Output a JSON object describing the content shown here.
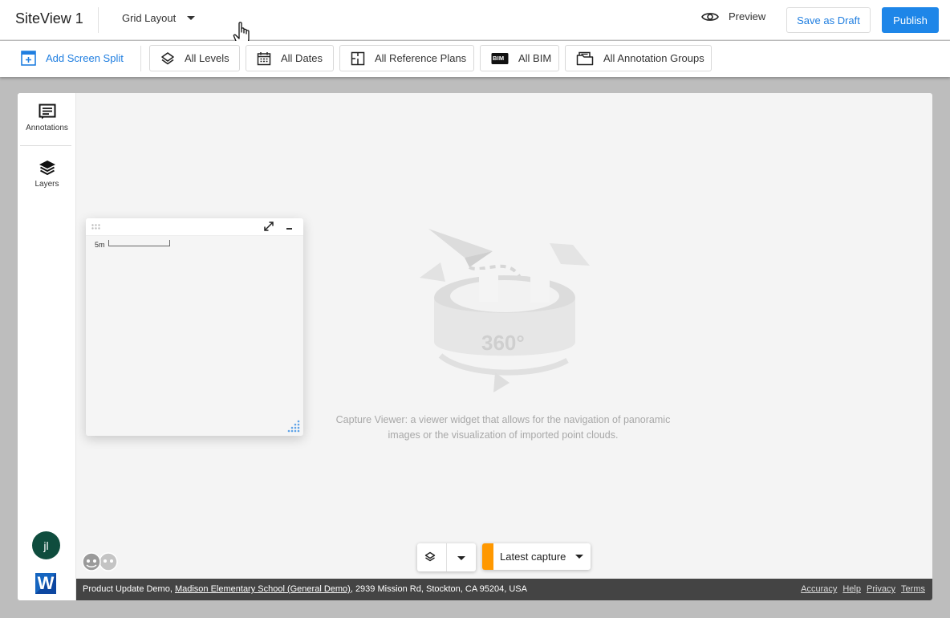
{
  "header": {
    "app_title": "SiteView 1",
    "layout_select": "Grid Layout",
    "preview_label": "Preview",
    "save_draft_label": "Save as Draft",
    "publish_label": "Publish"
  },
  "filters": {
    "add_screen_split": "Add Screen Split",
    "items": [
      {
        "label": "All Levels",
        "icon": "layers-icon"
      },
      {
        "label": "All Dates",
        "icon": "calendar-icon"
      },
      {
        "label": "All Reference Plans",
        "icon": "plan-icon"
      },
      {
        "label": "All BIM",
        "icon": "bim-icon",
        "badge": "BIM"
      },
      {
        "label": "All Annotation Groups",
        "icon": "folder-icon"
      }
    ]
  },
  "sidebar": {
    "items": [
      {
        "label": "Annotations",
        "icon": "annotations-icon"
      },
      {
        "label": "Layers",
        "icon": "layers-stack-icon"
      }
    ],
    "avatar_initials": "jl",
    "logo_letter": "W"
  },
  "viewer": {
    "badge_360": "360°",
    "description": "Capture Viewer: a viewer widget that allows for the navigation of panoramic images or the visualization of imported point clouds."
  },
  "minimap": {
    "scale_label": "5m"
  },
  "capture": {
    "selected": "Latest capture",
    "accent_color": "#ff9800"
  },
  "footer": {
    "project": "Product Update Demo, ",
    "site_link": "Madison Elementary School (General Demo)",
    "address": ", 2939 Mission Rd, Stockton, CA 95204, USA",
    "links": [
      "Accuracy",
      "Help",
      "Privacy",
      "Terms"
    ]
  },
  "colors": {
    "primary": "#1e86e8",
    "avatar": "#0f4d3e",
    "footer_bg": "#444444"
  }
}
